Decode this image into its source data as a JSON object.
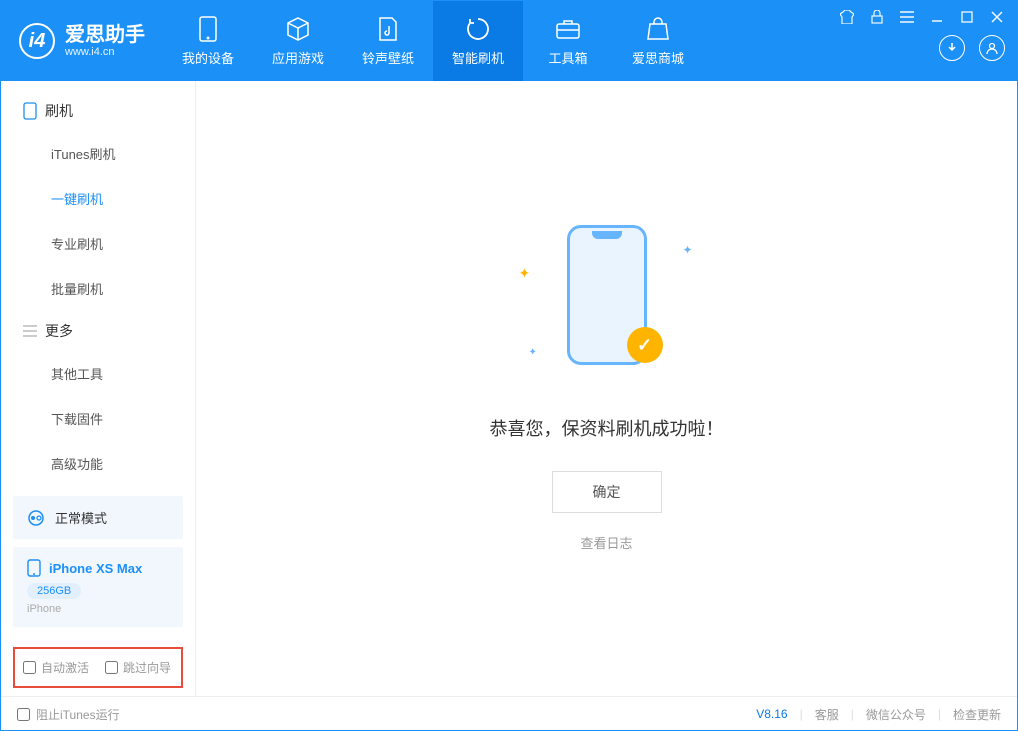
{
  "app": {
    "name": "爱思助手",
    "url": "www.i4.cn"
  },
  "tabs": {
    "device": "我的设备",
    "apps": "应用游戏",
    "ring": "铃声壁纸",
    "flash": "智能刷机",
    "tools": "工具箱",
    "store": "爱思商城"
  },
  "sidebar": {
    "sec_flash": "刷机",
    "itunes": "iTunes刷机",
    "oneclick": "一键刷机",
    "pro": "专业刷机",
    "batch": "批量刷机",
    "sec_more": "更多",
    "other": "其他工具",
    "firmware": "下载固件",
    "advanced": "高级功能"
  },
  "mode": {
    "label": "正常模式"
  },
  "device": {
    "name": "iPhone XS Max",
    "capacity": "256GB",
    "type": "iPhone"
  },
  "checks": {
    "auto_activate": "自动激活",
    "skip_guide": "跳过向导"
  },
  "main": {
    "message": "恭喜您，保资料刷机成功啦！",
    "ok": "确定",
    "view_log": "查看日志"
  },
  "footer": {
    "block_itunes": "阻止iTunes运行",
    "version": "V8.16",
    "support": "客服",
    "wechat": "微信公众号",
    "update": "检查更新"
  }
}
